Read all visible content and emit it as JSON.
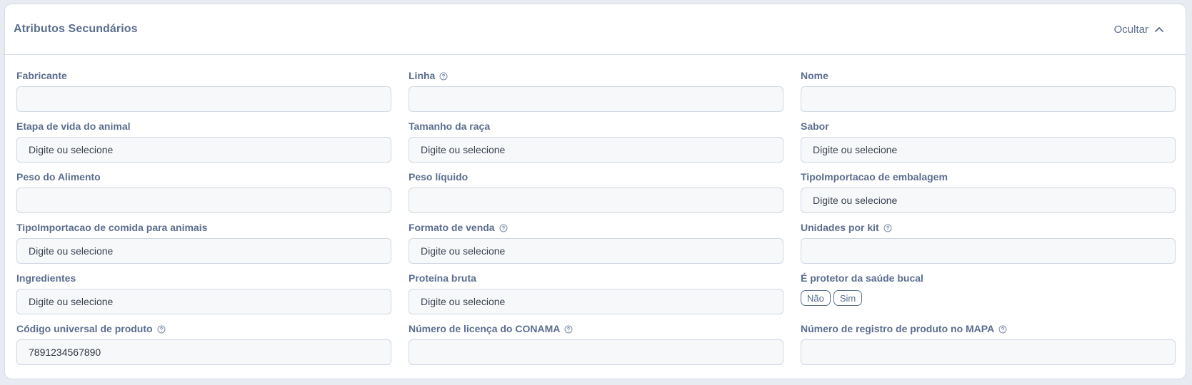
{
  "section": {
    "title": "Atributos Secundários",
    "toggle_label": "Ocultar"
  },
  "fields": [
    {
      "label": "Fabricante",
      "help": false,
      "placeholder": "",
      "value": ""
    },
    {
      "label": "Linha",
      "help": true,
      "placeholder": "",
      "value": ""
    },
    {
      "label": "Nome",
      "help": false,
      "placeholder": "",
      "value": ""
    },
    {
      "label": "Etapa de vida do animal",
      "help": false,
      "placeholder": "Digite ou selecione",
      "value": ""
    },
    {
      "label": "Tamanho da raça",
      "help": false,
      "placeholder": "Digite ou selecione",
      "value": ""
    },
    {
      "label": "Sabor",
      "help": false,
      "placeholder": "Digite ou selecione",
      "value": ""
    },
    {
      "label": "Peso do Alimento",
      "help": false,
      "placeholder": "",
      "value": ""
    },
    {
      "label": "Peso líquido",
      "help": false,
      "placeholder": "",
      "value": ""
    },
    {
      "label": "TipoImportacao de embalagem",
      "help": false,
      "placeholder": "Digite ou selecione",
      "value": ""
    },
    {
      "label": "TipoImportacao de comida para animais",
      "help": false,
      "placeholder": "Digite ou selecione",
      "value": ""
    },
    {
      "label": "Formato de venda",
      "help": true,
      "placeholder": "Digite ou selecione",
      "value": ""
    },
    {
      "label": "Unidades por kit",
      "help": true,
      "placeholder": "",
      "value": ""
    },
    {
      "label": "Ingredientes",
      "help": false,
      "placeholder": "Digite ou selecione",
      "value": ""
    },
    {
      "label": "Proteína bruta",
      "help": false,
      "placeholder": "Digite ou selecione",
      "value": ""
    },
    {
      "label": "É protetor da saúde bucal",
      "help": false,
      "choices": [
        "Não",
        "Sim"
      ]
    },
    {
      "label": "Código universal de produto",
      "help": true,
      "placeholder": "",
      "value": "7891234567890"
    },
    {
      "label": "Número de licença do CONAMA",
      "help": true,
      "placeholder": "",
      "value": ""
    },
    {
      "label": "Número de registro de produto no MAPA",
      "help": true,
      "placeholder": "",
      "value": ""
    }
  ],
  "icons": {
    "toggle": "chevron-up-icon",
    "help": "help-circle-icon"
  },
  "colors": {
    "label": "#5b6e8f",
    "border": "#d4dbe6",
    "input_bg": "#f7f8f9"
  }
}
